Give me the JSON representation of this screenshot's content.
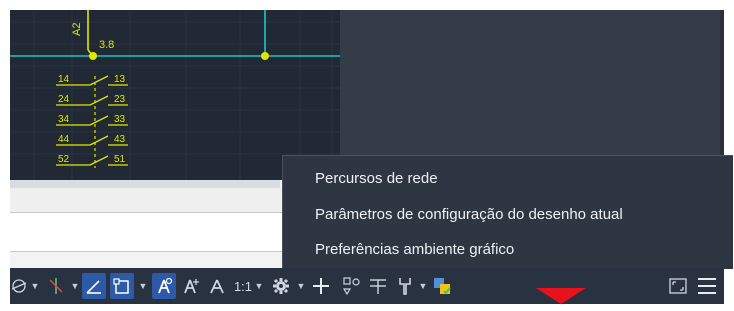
{
  "canvas": {
    "wire_label": "A2",
    "node_label": "3.8",
    "contacts": [
      {
        "left": "14",
        "right": "13"
      },
      {
        "left": "24",
        "right": "23"
      },
      {
        "left": "34",
        "right": "33"
      },
      {
        "left": "44",
        "right": "43"
      },
      {
        "left": "52",
        "right": "51"
      }
    ]
  },
  "context_menu": {
    "items": [
      {
        "label": "Percursos de rede"
      },
      {
        "label": "Parâmetros de configuração do desenho atual"
      },
      {
        "label": "Preferências ambiente gráfico"
      }
    ]
  },
  "status_bar": {
    "scale_label": "1:1",
    "icons": [
      "polar-tracking-icon",
      "ortho-icon",
      "isodraft-angle-icon",
      "object-snap-tracking-icon",
      "annotation-visibility-icon",
      "auto-scale-icon",
      "annotation-scale-icon",
      "workspace-gear-icon",
      "add-icon",
      "units-icon",
      "quick-properties-icon",
      "customization-icon",
      "isolate-objects-icon",
      "fullscreen-icon",
      "menu-icon"
    ]
  },
  "colors": {
    "canvas_bg": "#202934",
    "wire_cyan": "#1fc6c6",
    "contact_yellow": "#e2e600",
    "menu_bg": "#2e3642",
    "status_bg": "#293240",
    "active_blue": "#2c5aa6",
    "marker_red": "#e8121c"
  }
}
